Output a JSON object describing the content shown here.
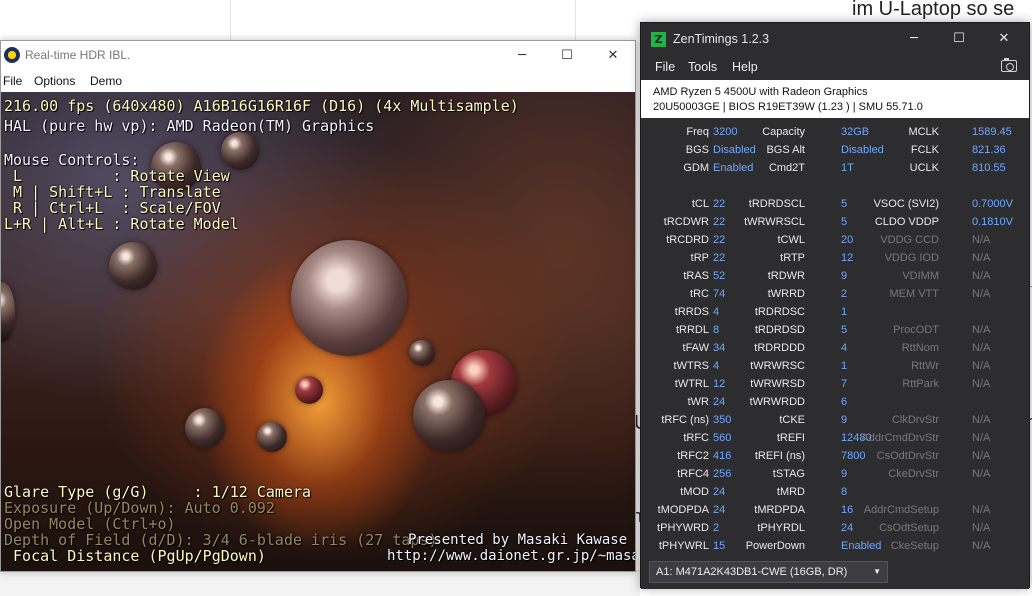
{
  "background": {
    "top_text": "im U-Laptop so se",
    "right_fragment_1": "U",
    "right_fragment_2": "n",
    "bottom_fragment": "n"
  },
  "hdr_window": {
    "title": "Real-time HDR IBL.",
    "menu": [
      "File",
      "Options",
      "Demo"
    ],
    "controls": {
      "minimize": "─",
      "maximize": "☐",
      "close": "✕"
    },
    "osd": {
      "fps_line": "216.00 fps (640x480) A16B16G16R16F (D16) (4x Multisample)",
      "hal_line": "HAL (pure hw vp): AMD Radeon(TM) Graphics",
      "mouse_title": "Mouse Controls:",
      "mouse_rows": [
        " L          : Rotate View",
        " M | Shift+L : Translate",
        " R | Ctrl+L  : Scale/FOV",
        "L+R | Alt+L : Rotate Model"
      ],
      "glare": "Glare Type (g/G)     : 1/12 Camera",
      "exposure": "Exposure (Up/Down): Auto 0.092",
      "open_model": "Open Model (Ctrl+o)",
      "dof": "Depth of Field (d/D): 3/4 6-blade iris (27 taps)",
      "focal": " Focal Distance (PgUp/PgDown)",
      "presented": "Presented by Masaki Kawase",
      "url": "http://www.daionet.gr.jp/~masa"
    }
  },
  "zen_window": {
    "title": "ZenTimings 1.2.3",
    "logo": "Z",
    "controls": {
      "minimize": "─",
      "maximize": "☐",
      "close": "✕"
    },
    "menu": [
      "File",
      "Tools",
      "Help"
    ],
    "info": {
      "cpu": "AMD Ryzen 5 4500U with Radeon Graphics",
      "bios": "20U50003GE | BIOS R19ET39W (1.23 ) | SMU 55.71.0"
    },
    "col1": [
      {
        "label": "Freq",
        "value": "3200"
      },
      {
        "label": "BGS",
        "value": "Disabled"
      },
      {
        "label": "GDM",
        "value": "Enabled"
      },
      {
        "label": "",
        "value": ""
      },
      {
        "label": "tCL",
        "value": "22"
      },
      {
        "label": "tRCDWR",
        "value": "22"
      },
      {
        "label": "tRCDRD",
        "value": "22"
      },
      {
        "label": "tRP",
        "value": "22"
      },
      {
        "label": "tRAS",
        "value": "52"
      },
      {
        "label": "tRC",
        "value": "74"
      },
      {
        "label": "tRRDS",
        "value": "4"
      },
      {
        "label": "tRRDL",
        "value": "8"
      },
      {
        "label": "tFAW",
        "value": "34"
      },
      {
        "label": "tWTRS",
        "value": "4"
      },
      {
        "label": "tWTRL",
        "value": "12"
      },
      {
        "label": "tWR",
        "value": "24"
      },
      {
        "label": "tRFC (ns)",
        "value": "350"
      },
      {
        "label": "tRFC",
        "value": "560"
      },
      {
        "label": "tRFC2",
        "value": "416"
      },
      {
        "label": "tRFC4",
        "value": "256"
      },
      {
        "label": "tMOD",
        "value": "24"
      },
      {
        "label": "tMODPDA",
        "value": "24"
      },
      {
        "label": "tPHYWRD",
        "value": "2"
      },
      {
        "label": "tPHYWRL",
        "value": "15"
      }
    ],
    "col2": [
      {
        "label": "Capacity",
        "value": "32GB"
      },
      {
        "label": "BGS Alt",
        "value": "Disabled"
      },
      {
        "label": "Cmd2T",
        "value": "1T"
      },
      {
        "label": "",
        "value": ""
      },
      {
        "label": "tRDRDSCL",
        "value": "5"
      },
      {
        "label": "tWRWRSCL",
        "value": "5"
      },
      {
        "label": "tCWL",
        "value": "20"
      },
      {
        "label": "tRTP",
        "value": "12"
      },
      {
        "label": "tRDWR",
        "value": "9"
      },
      {
        "label": "tWRRD",
        "value": "2"
      },
      {
        "label": "tRDRDSC",
        "value": "1"
      },
      {
        "label": "tRDRDSD",
        "value": "5"
      },
      {
        "label": "tRDRDDD",
        "value": "4"
      },
      {
        "label": "tWRWRSC",
        "value": "1"
      },
      {
        "label": "tWRWRSD",
        "value": "7"
      },
      {
        "label": "tWRWRDD",
        "value": "6"
      },
      {
        "label": "tCKE",
        "value": "9"
      },
      {
        "label": "tREFI",
        "value": "12480"
      },
      {
        "label": "tREFI (ns)",
        "value": "7800"
      },
      {
        "label": "tSTAG",
        "value": "9"
      },
      {
        "label": "tMRD",
        "value": "8"
      },
      {
        "label": "tMRDPDA",
        "value": "16"
      },
      {
        "label": "tPHYRDL",
        "value": "24"
      },
      {
        "label": "PowerDown",
        "value": "Enabled"
      }
    ],
    "col3": [
      {
        "label": "MCLK",
        "value": "1589.45",
        "dim": false
      },
      {
        "label": "FCLK",
        "value": "821.36",
        "dim": false
      },
      {
        "label": "UCLK",
        "value": "810.55",
        "dim": false
      },
      {
        "label": "",
        "value": "",
        "dim": false
      },
      {
        "label": "VSOC (SVI2)",
        "value": "0.7000V",
        "dim": false
      },
      {
        "label": "CLDO VDDP",
        "value": "0.1810V",
        "dim": false
      },
      {
        "label": "VDDG CCD",
        "value": "N/A",
        "dim": true
      },
      {
        "label": "VDDG IOD",
        "value": "N/A",
        "dim": true
      },
      {
        "label": "VDIMM",
        "value": "N/A",
        "dim": true
      },
      {
        "label": "MEM VTT",
        "value": "N/A",
        "dim": true
      },
      {
        "label": "",
        "value": "",
        "dim": true
      },
      {
        "label": "ProcODT",
        "value": "N/A",
        "dim": true
      },
      {
        "label": "RttNom",
        "value": "N/A",
        "dim": true
      },
      {
        "label": "RttWr",
        "value": "N/A",
        "dim": true
      },
      {
        "label": "RttPark",
        "value": "N/A",
        "dim": true
      },
      {
        "label": "",
        "value": "",
        "dim": true
      },
      {
        "label": "ClkDrvStr",
        "value": "N/A",
        "dim": true
      },
      {
        "label": "AddrCmdDrvStr",
        "value": "N/A",
        "dim": true
      },
      {
        "label": "CsOdtDrvStr",
        "value": "N/A",
        "dim": true
      },
      {
        "label": "CkeDrvStr",
        "value": "N/A",
        "dim": true
      },
      {
        "label": "",
        "value": "",
        "dim": true
      },
      {
        "label": "AddrCmdSetup",
        "value": "N/A",
        "dim": true
      },
      {
        "label": "CsOdtSetup",
        "value": "N/A",
        "dim": true
      },
      {
        "label": "CkeSetup",
        "value": "N/A",
        "dim": true
      }
    ],
    "dimm_select": "A1: M471A2K43DB1-CWE (16GB, DR)"
  }
}
